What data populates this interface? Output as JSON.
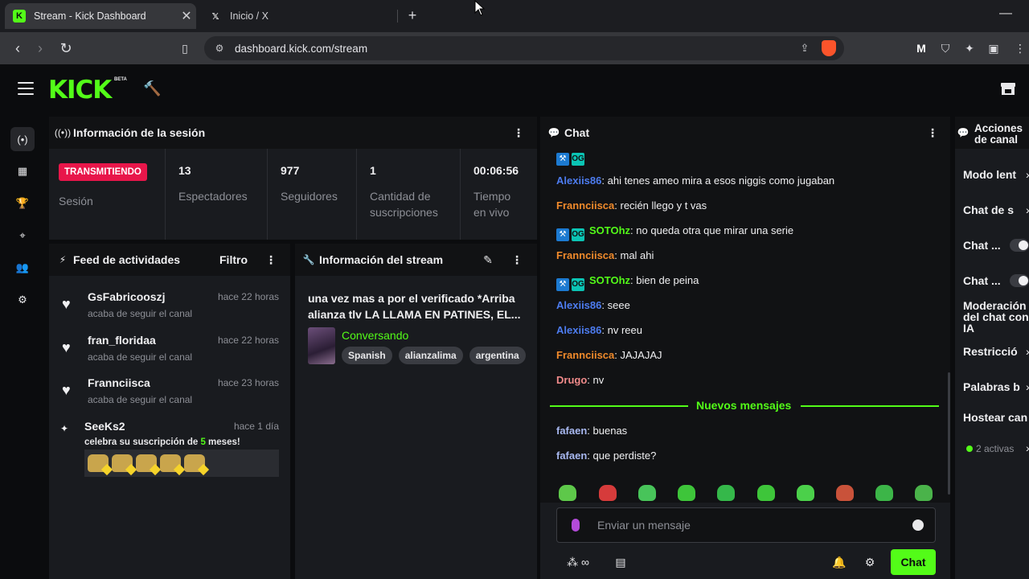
{
  "browser": {
    "tabs": [
      {
        "title": "Stream - Kick Dashboard",
        "favicon": "kick-icon",
        "active": true
      },
      {
        "title": "Inicio / X",
        "favicon": "x-icon",
        "active": false
      }
    ],
    "url": "dashboard.kick.com/stream"
  },
  "app": {
    "logo": "KICK",
    "beta": "BETA"
  },
  "session": {
    "title": "Información de la sesión",
    "live_badge": "TRANSMITIENDO",
    "session_label": "Sesión",
    "stats": [
      {
        "value": "13",
        "label": "Espectadores"
      },
      {
        "value": "977",
        "label": "Seguidores"
      },
      {
        "value": "1",
        "label": "Cantidad de suscripciones"
      },
      {
        "value": "00:06:56",
        "label": "Tiempo en vivo"
      }
    ]
  },
  "feed": {
    "title": "Feed de actividades",
    "filter": "Filtro",
    "items": [
      {
        "name": "GsFabricooszj",
        "time": "hace 22 horas",
        "desc": "acaba de seguir el canal"
      },
      {
        "name": "fran_floridaa",
        "time": "hace 22 horas",
        "desc": "acaba de seguir el canal"
      },
      {
        "name": "Frannciisca",
        "time": "hace 23 horas",
        "desc": "acaba de seguir el canal"
      }
    ],
    "sub": {
      "name": "SeeKs2",
      "time": "hace 1 día",
      "desc_pre": "celebra su suscripción de ",
      "months": "5",
      "desc_post": " meses!"
    }
  },
  "stream_info": {
    "title": "Información del stream",
    "stream_title": "una vez mas a por el verificado *Arriba alianza tlv LA LLAMA EN PATINES, EL...",
    "category": "Conversando",
    "tags": [
      "Spanish",
      "alianzalima",
      "argentina"
    ]
  },
  "chat": {
    "title": "Chat",
    "messages": [
      {
        "user": "Alexiis86",
        "text": "ahi tenes ameo mira a esos niggis como jugaban",
        "color": "#4d7cf0",
        "badges": false
      },
      {
        "user": "Frannciisca",
        "text": "recién llego y t vas",
        "color": "#f08a2b",
        "badges": false
      },
      {
        "user": "SOTOhz",
        "text": "no queda otra que mirar una serie",
        "color": "#53fc18",
        "badges": true
      },
      {
        "user": "Frannciisca",
        "text": "mal ahi",
        "color": "#f08a2b",
        "badges": false
      },
      {
        "user": "SOTOhz",
        "text": "bien de peina",
        "color": "#53fc18",
        "badges": true
      },
      {
        "user": "Alexiis86",
        "text": "seee",
        "color": "#4d7cf0",
        "badges": false
      },
      {
        "user": "Alexiis86",
        "text": "nv reeu",
        "color": "#4d7cf0",
        "badges": false
      },
      {
        "user": "Frannciisca",
        "text": "JAJAJAJ",
        "color": "#f08a2b",
        "badges": false
      },
      {
        "user": "Drugo",
        "text": "nv",
        "color": "#f08a8a",
        "badges": false
      }
    ],
    "new_messages_label": "Nuevos mensajes",
    "new_messages": [
      {
        "user": "fafaen",
        "text": "buenas",
        "color": "#a8b8f0"
      },
      {
        "user": "fafaen",
        "text": "que perdiste?",
        "color": "#a8b8f0"
      }
    ],
    "input_placeholder": "Enviar un mensaje",
    "send_label": "Chat"
  },
  "channel_actions": {
    "title_line1": "Acciones",
    "title_line2": "de canal",
    "items": [
      {
        "label": "Modo lent",
        "type": "chevron"
      },
      {
        "label": "Chat de s",
        "type": "chevron"
      },
      {
        "label": "Chat ...",
        "type": "toggle"
      },
      {
        "label": "Chat ...",
        "type": "toggle"
      },
      {
        "label": "Moderación del chat con IA",
        "type": "none"
      },
      {
        "label": "Restricció",
        "type": "chevron"
      },
      {
        "label": "Palabras b",
        "type": "chevron"
      },
      {
        "label": "Hostear can",
        "type": "none"
      }
    ],
    "active_count": "2 activas"
  }
}
